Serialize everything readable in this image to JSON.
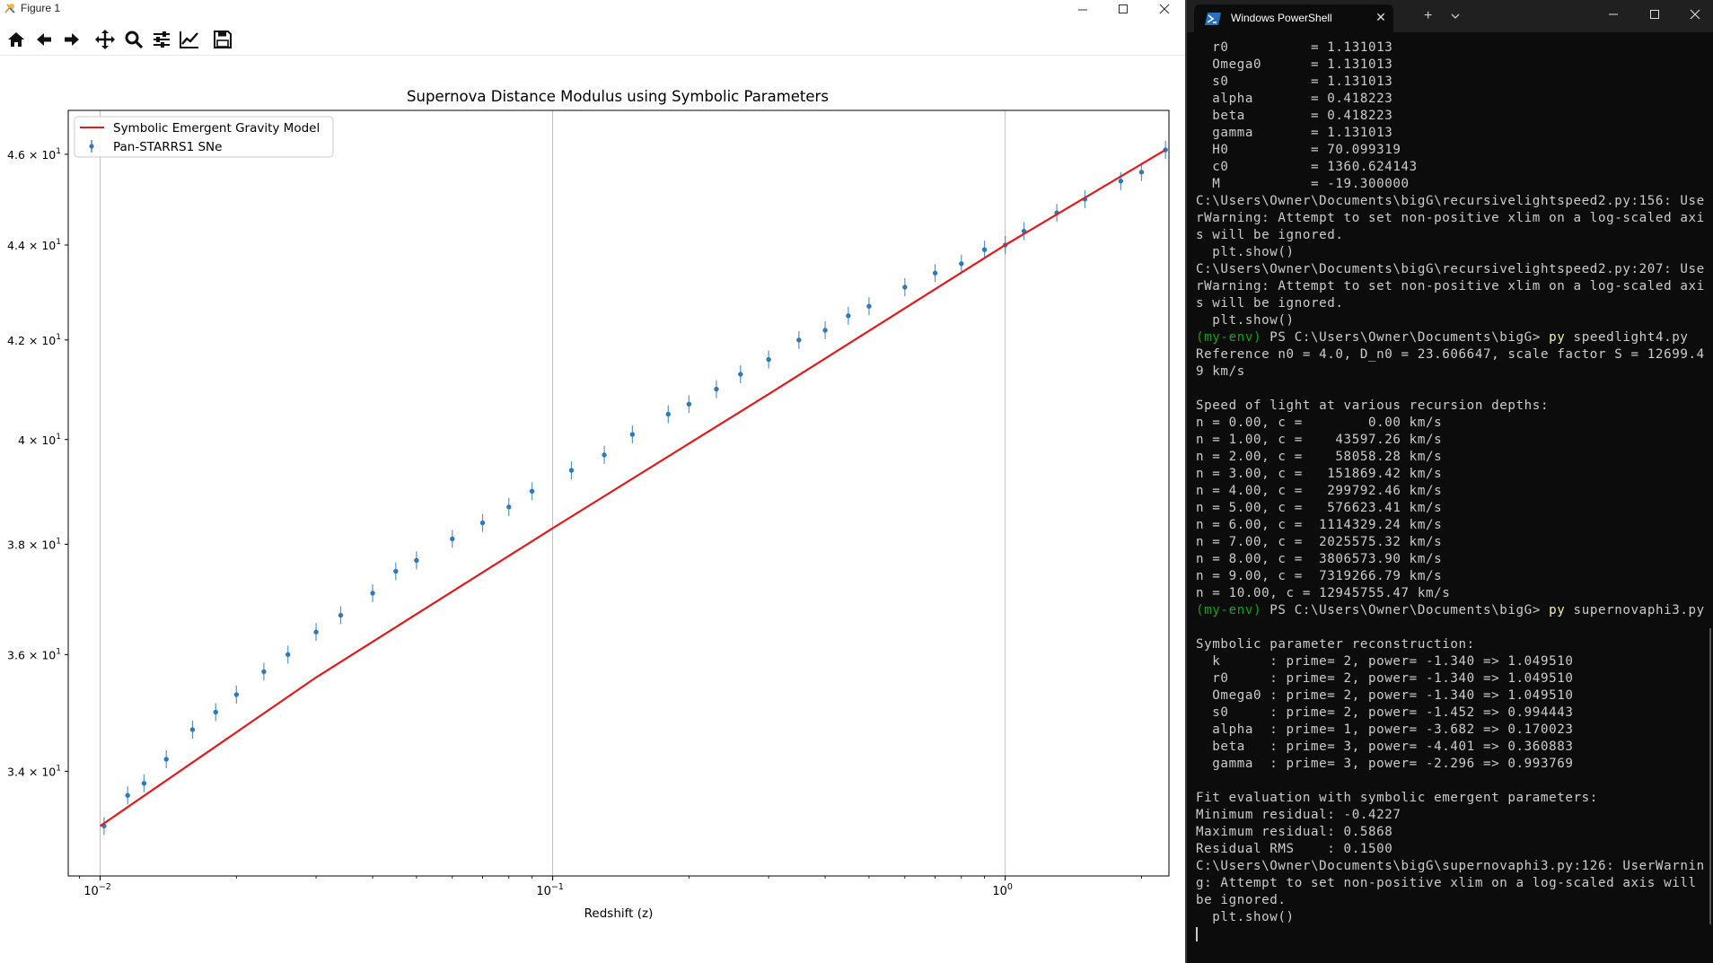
{
  "figure_window": {
    "title": "Figure 1",
    "toolbar": [
      "home",
      "back",
      "forward",
      "pan",
      "zoom",
      "configure-subplots",
      "edit-axis",
      "save"
    ]
  },
  "chart_data": {
    "type": "line",
    "title": "Supernova Distance Modulus using Symbolic Parameters",
    "xlabel": "Redshift (z)",
    "ylabel": "",
    "xscale": "log",
    "yscale": "log",
    "xlim": [
      0.0085,
      2.3
    ],
    "ylim": [
      32.3,
      47.0
    ],
    "grid": "x-major",
    "legend_position": "upper-left",
    "x_ticks": [
      {
        "base": "10",
        "exp": "−2"
      },
      {
        "base": "10",
        "exp": "−1"
      },
      {
        "base": "10",
        "exp": "0"
      }
    ],
    "y_ticks": [
      {
        "mant": "3.4",
        "exp": "1"
      },
      {
        "mant": "3.6",
        "exp": "1"
      },
      {
        "mant": "3.8",
        "exp": "1"
      },
      {
        "mant": "4",
        "exp": "1"
      },
      {
        "mant": "4.2",
        "exp": "1"
      },
      {
        "mant": "4.4",
        "exp": "1"
      },
      {
        "mant": "4.6",
        "exp": "1"
      }
    ],
    "series": [
      {
        "name": "Symbolic Emergent Gravity Model",
        "kind": "line",
        "color": "#e41a1c",
        "x": [
          0.01,
          0.03,
          0.1,
          0.3,
          1.0,
          2.26
        ],
        "y": [
          33.1,
          35.6,
          38.3,
          40.9,
          44.0,
          46.1
        ]
      },
      {
        "name": "Pan-STARRS1 SNe",
        "kind": "errorbar",
        "color": "#2e7ab8",
        "x": [
          0.0102,
          0.0115,
          0.0125,
          0.014,
          0.016,
          0.018,
          0.02,
          0.023,
          0.026,
          0.03,
          0.034,
          0.04,
          0.045,
          0.05,
          0.06,
          0.07,
          0.08,
          0.09,
          0.11,
          0.13,
          0.15,
          0.18,
          0.2,
          0.23,
          0.26,
          0.3,
          0.35,
          0.4,
          0.45,
          0.5,
          0.6,
          0.7,
          0.8,
          0.9,
          1.0,
          1.1,
          1.3,
          1.5,
          1.8,
          2.0,
          2.26
        ],
        "y": [
          33.1,
          33.6,
          33.8,
          34.2,
          34.7,
          35.0,
          35.3,
          35.7,
          36.0,
          36.4,
          36.7,
          37.1,
          37.5,
          37.7,
          38.1,
          38.4,
          38.7,
          39.0,
          39.4,
          39.7,
          40.1,
          40.5,
          40.7,
          41.0,
          41.3,
          41.6,
          42.0,
          42.2,
          42.5,
          42.7,
          43.1,
          43.4,
          43.6,
          43.9,
          44.0,
          44.3,
          44.7,
          45.0,
          45.4,
          45.6,
          46.1
        ]
      }
    ]
  },
  "terminal": {
    "tab_title": "Windows PowerShell",
    "new_tab": "+",
    "lines": [
      [
        {
          "t": "  r0          = 1.131013"
        }
      ],
      [
        {
          "t": "  Omega0      = 1.131013"
        }
      ],
      [
        {
          "t": "  s0          = 1.131013"
        }
      ],
      [
        {
          "t": "  alpha       = 0.418223"
        }
      ],
      [
        {
          "t": "  beta        = 0.418223"
        }
      ],
      [
        {
          "t": "  gamma       = 1.131013"
        }
      ],
      [
        {
          "t": "  H0          = 70.099319"
        }
      ],
      [
        {
          "t": "  c0          = 1360.624143"
        }
      ],
      [
        {
          "t": "  M           = -19.300000"
        }
      ],
      [
        {
          "t": "C:\\Users\\Owner\\Documents\\bigG\\recursivelightspeed2.py:156: Use"
        }
      ],
      [
        {
          "t": "rWarning: Attempt to set non-positive xlim on a log-scaled axi"
        }
      ],
      [
        {
          "t": "s will be ignored."
        }
      ],
      [
        {
          "t": "  plt.show()"
        }
      ],
      [
        {
          "t": "C:\\Users\\Owner\\Documents\\bigG\\recursivelightspeed2.py:207: Use"
        }
      ],
      [
        {
          "t": "rWarning: Attempt to set non-positive xlim on a log-scaled axi"
        }
      ],
      [
        {
          "t": "s will be ignored."
        }
      ],
      [
        {
          "t": "  plt.show()"
        }
      ],
      [
        {
          "t": "(my-env)",
          "c": "green"
        },
        {
          "t": " PS C:\\Users\\Owner\\Documents\\bigG> "
        },
        {
          "t": "py",
          "c": "yellow"
        },
        {
          "t": " speedlight4.py"
        }
      ],
      [
        {
          "t": "Reference n0 = 4.0, D_n0 = 23.606647, scale factor S = 12699.4"
        }
      ],
      [
        {
          "t": "9 km/s"
        }
      ],
      [
        {
          "t": ""
        }
      ],
      [
        {
          "t": "Speed of light at various recursion depths:"
        }
      ],
      [
        {
          "t": "n = 0.00, c =        0.00 km/s"
        }
      ],
      [
        {
          "t": "n = 1.00, c =    43597.26 km/s"
        }
      ],
      [
        {
          "t": "n = 2.00, c =    58058.28 km/s"
        }
      ],
      [
        {
          "t": "n = 3.00, c =   151869.42 km/s"
        }
      ],
      [
        {
          "t": "n = 4.00, c =   299792.46 km/s"
        }
      ],
      [
        {
          "t": "n = 5.00, c =   576623.41 km/s"
        }
      ],
      [
        {
          "t": "n = 6.00, c =  1114329.24 km/s"
        }
      ],
      [
        {
          "t": "n = 7.00, c =  2025575.32 km/s"
        }
      ],
      [
        {
          "t": "n = 8.00, c =  3806573.90 km/s"
        }
      ],
      [
        {
          "t": "n = 9.00, c =  7319266.79 km/s"
        }
      ],
      [
        {
          "t": "n = 10.00, c = 12945755.47 km/s"
        }
      ],
      [
        {
          "t": "(my-env)",
          "c": "green"
        },
        {
          "t": " PS C:\\Users\\Owner\\Documents\\bigG> "
        },
        {
          "t": "py",
          "c": "yellow"
        },
        {
          "t": " supernovaphi3.py"
        }
      ],
      [
        {
          "t": ""
        }
      ],
      [
        {
          "t": "Symbolic parameter reconstruction:"
        }
      ],
      [
        {
          "t": "  k      : prime= 2, power= -1.340 => 1.049510"
        }
      ],
      [
        {
          "t": "  r0     : prime= 2, power= -1.340 => 1.049510"
        }
      ],
      [
        {
          "t": "  Omega0 : prime= 2, power= -1.340 => 1.049510"
        }
      ],
      [
        {
          "t": "  s0     : prime= 2, power= -1.452 => 0.994443"
        }
      ],
      [
        {
          "t": "  alpha  : prime= 1, power= -3.682 => 0.170023"
        }
      ],
      [
        {
          "t": "  beta   : prime= 3, power= -4.401 => 0.360883"
        }
      ],
      [
        {
          "t": "  gamma  : prime= 3, power= -2.296 => 0.993769"
        }
      ],
      [
        {
          "t": ""
        }
      ],
      [
        {
          "t": "Fit evaluation with symbolic emergent parameters:"
        }
      ],
      [
        {
          "t": "Minimum residual: -0.4227"
        }
      ],
      [
        {
          "t": "Maximum residual: 0.5868"
        }
      ],
      [
        {
          "t": "Residual RMS    : 0.1500"
        }
      ],
      [
        {
          "t": "C:\\Users\\Owner\\Documents\\bigG\\supernovaphi3.py:126: UserWarnin"
        }
      ],
      [
        {
          "t": "g: Attempt to set non-positive xlim on a log-scaled axis will"
        }
      ],
      [
        {
          "t": "be ignored."
        }
      ],
      [
        {
          "t": "  plt.show()"
        }
      ]
    ]
  }
}
